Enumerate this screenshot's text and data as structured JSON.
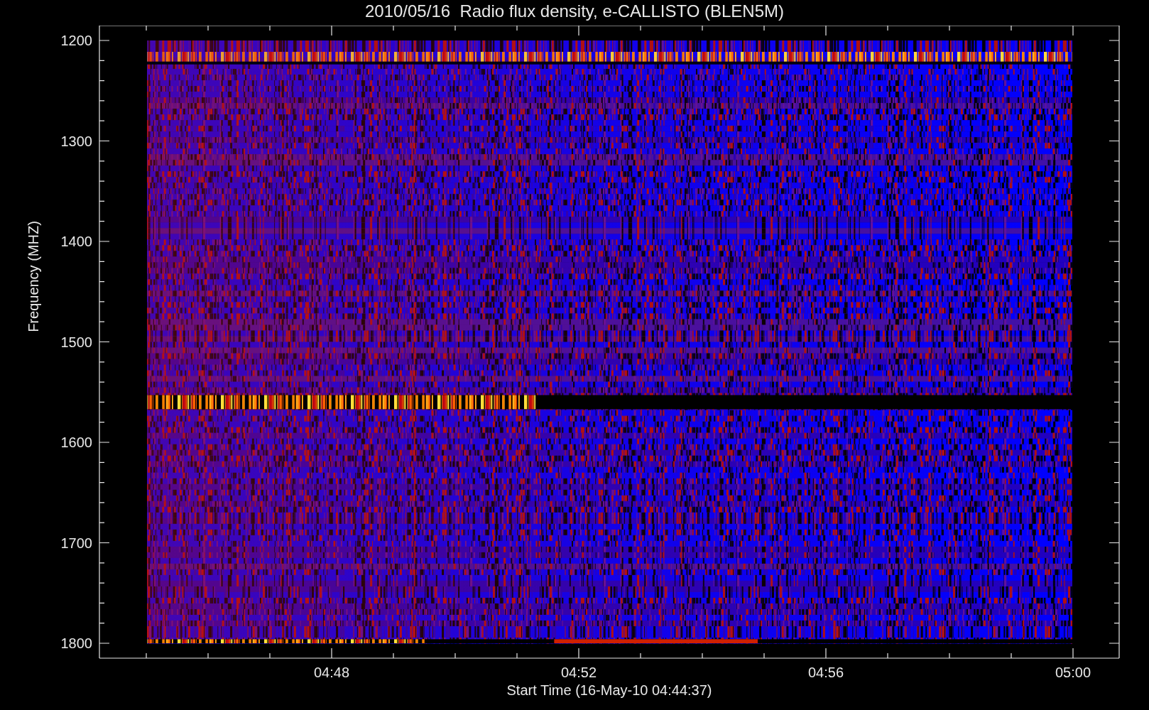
{
  "title": "2010/05/16  Radio flux density, e-CALLISTO (BLEN5M)",
  "y_axis": {
    "label": "Frequency (MHZ)",
    "ticks": [
      "1200",
      "1300",
      "1400",
      "1500",
      "1600",
      "1700",
      "1800"
    ]
  },
  "x_axis": {
    "label": "Start Time (16-May-10 04:44:37)",
    "ticks": [
      "04:48",
      "04:52",
      "04:56",
      "05:00"
    ]
  }
}
